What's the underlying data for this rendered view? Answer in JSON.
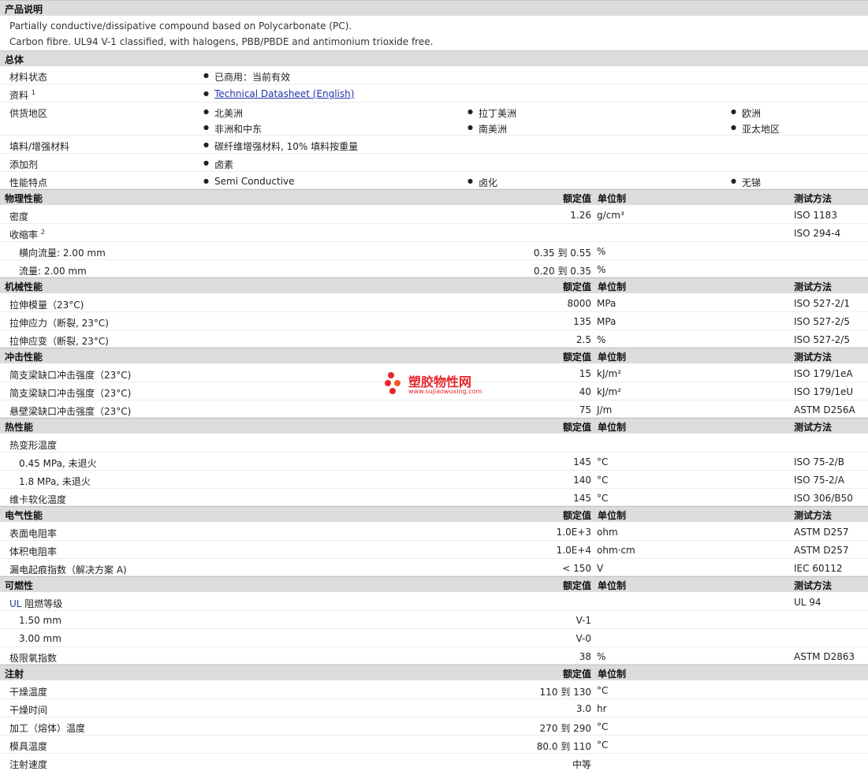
{
  "desc": {
    "title": "产品说明",
    "line1": "Partially conductive/dissipative compound based on Polycarbonate (PC).",
    "line2": "Carbon fibre. UL94 V-1 classified, with halogens, PBB/PBDE and antimonium trioxide free."
  },
  "general": {
    "title": "总体",
    "status_label": "材料状态",
    "status_value": "已商用：当前有效",
    "docs_label": "资料",
    "docs_sup": "1",
    "docs_link": "Technical Datasheet (English)",
    "region_label": "供货地区",
    "regions": [
      "北美洲",
      "拉丁美洲",
      "欧洲",
      "非洲和中东",
      "南美洲",
      "亚太地区"
    ],
    "filler_label": "填料/增强材料",
    "filler_value": "碳纤维增强材料, 10% 填料按重量",
    "additive_label": "添加剂",
    "additive_value": "卤素",
    "features_label": "性能特点",
    "features": [
      "Semi Conductive",
      "卤化",
      "无锑"
    ]
  },
  "headers": {
    "value": "额定值",
    "unit": "单位制",
    "method": "测试方法"
  },
  "physical": {
    "title": "物理性能",
    "density_label": "密度",
    "density_value": "1.26",
    "density_unit": "g/cm³",
    "density_method": "ISO 1183",
    "shrink_label": "收缩率",
    "shrink_sup": "2",
    "shrink_method": "ISO 294-4",
    "shrink_trans_label": "横向流量: 2.00 mm",
    "shrink_trans_value": "0.35 到  0.55",
    "shrink_trans_unit": "%",
    "shrink_flow_label": "流量: 2.00 mm",
    "shrink_flow_value": "0.20 到  0.35",
    "shrink_flow_unit": "%"
  },
  "mechanical": {
    "title": "机械性能",
    "rows": [
      {
        "label": "拉伸模量（23°C)",
        "value": "8000",
        "unit": "MPa",
        "method": "ISO 527-2/1"
      },
      {
        "label": "拉伸应力（断裂, 23°C)",
        "value": "135",
        "unit": "MPa",
        "method": "ISO 527-2/5"
      },
      {
        "label": "拉伸应变（断裂, 23°C)",
        "value": "2.5",
        "unit": "%",
        "method": "ISO 527-2/5"
      }
    ]
  },
  "impact": {
    "title": "冲击性能",
    "rows": [
      {
        "label": "简支梁缺口冲击强度（23°C)",
        "value": "15",
        "unit": "kJ/m²",
        "method": "ISO 179/1eA"
      },
      {
        "label": "简支梁缺口冲击强度（23°C)",
        "value": "40",
        "unit": "kJ/m²",
        "method": "ISO 179/1eU"
      },
      {
        "label": "悬壁梁缺口冲击强度（23°C)",
        "value": "75",
        "unit": "J/m",
        "method": "ASTM D256A"
      }
    ]
  },
  "thermal": {
    "title": "热性能",
    "hdt_label": "热变形温度",
    "hdt1_label": "0.45 MPa, 未退火",
    "hdt1_value": "145",
    "hdt1_unit": "°C",
    "hdt1_method": "ISO 75-2/B",
    "hdt2_label": "1.8 MPa, 未退火",
    "hdt2_value": "140",
    "hdt2_unit": "°C",
    "hdt2_method": "ISO 75-2/A",
    "vicat_label": "维卡软化温度",
    "vicat_value": "145",
    "vicat_unit": "°C",
    "vicat_method": "ISO 306/B50"
  },
  "electrical": {
    "title": "电气性能",
    "rows": [
      {
        "label": "表面电阻率",
        "value": "1.0E+3",
        "unit": "ohm",
        "method": "ASTM D257"
      },
      {
        "label": "体积电阻率",
        "value": "1.0E+4",
        "unit": "ohm·cm",
        "method": "ASTM D257"
      },
      {
        "label": "漏电起痕指数（解决方案  A)",
        "value": "< 150",
        "unit": "V",
        "method": "IEC 60112"
      }
    ]
  },
  "flammability": {
    "title": "可燃性",
    "ul_prefix": "UL",
    "ul_label": " 阻燃等级",
    "ul_method": "UL 94",
    "ul1_label": "1.50 mm",
    "ul1_value": "V-1",
    "ul2_label": "3.00 mm",
    "ul2_value": "V-0",
    "loi_label": "极限氧指数",
    "loi_value": "38",
    "loi_unit": "%",
    "loi_method": "ASTM D2863"
  },
  "injection": {
    "title": "注射",
    "rows": [
      {
        "label": "干燥温度",
        "value": "110 到  130",
        "unit": "°C"
      },
      {
        "label": "干燥时间",
        "value": "3.0",
        "unit": "hr"
      },
      {
        "label": "加工（熔体）温度",
        "value": "270 到  290",
        "unit": "°C"
      },
      {
        "label": "模具温度",
        "value": "80.0 到  110",
        "unit": "°C"
      },
      {
        "label": "注射速度",
        "value": "中等",
        "unit": ""
      }
    ]
  },
  "watermark": {
    "name": "塑胶物性网",
    "url": "www.sujiaowuxing.com"
  }
}
